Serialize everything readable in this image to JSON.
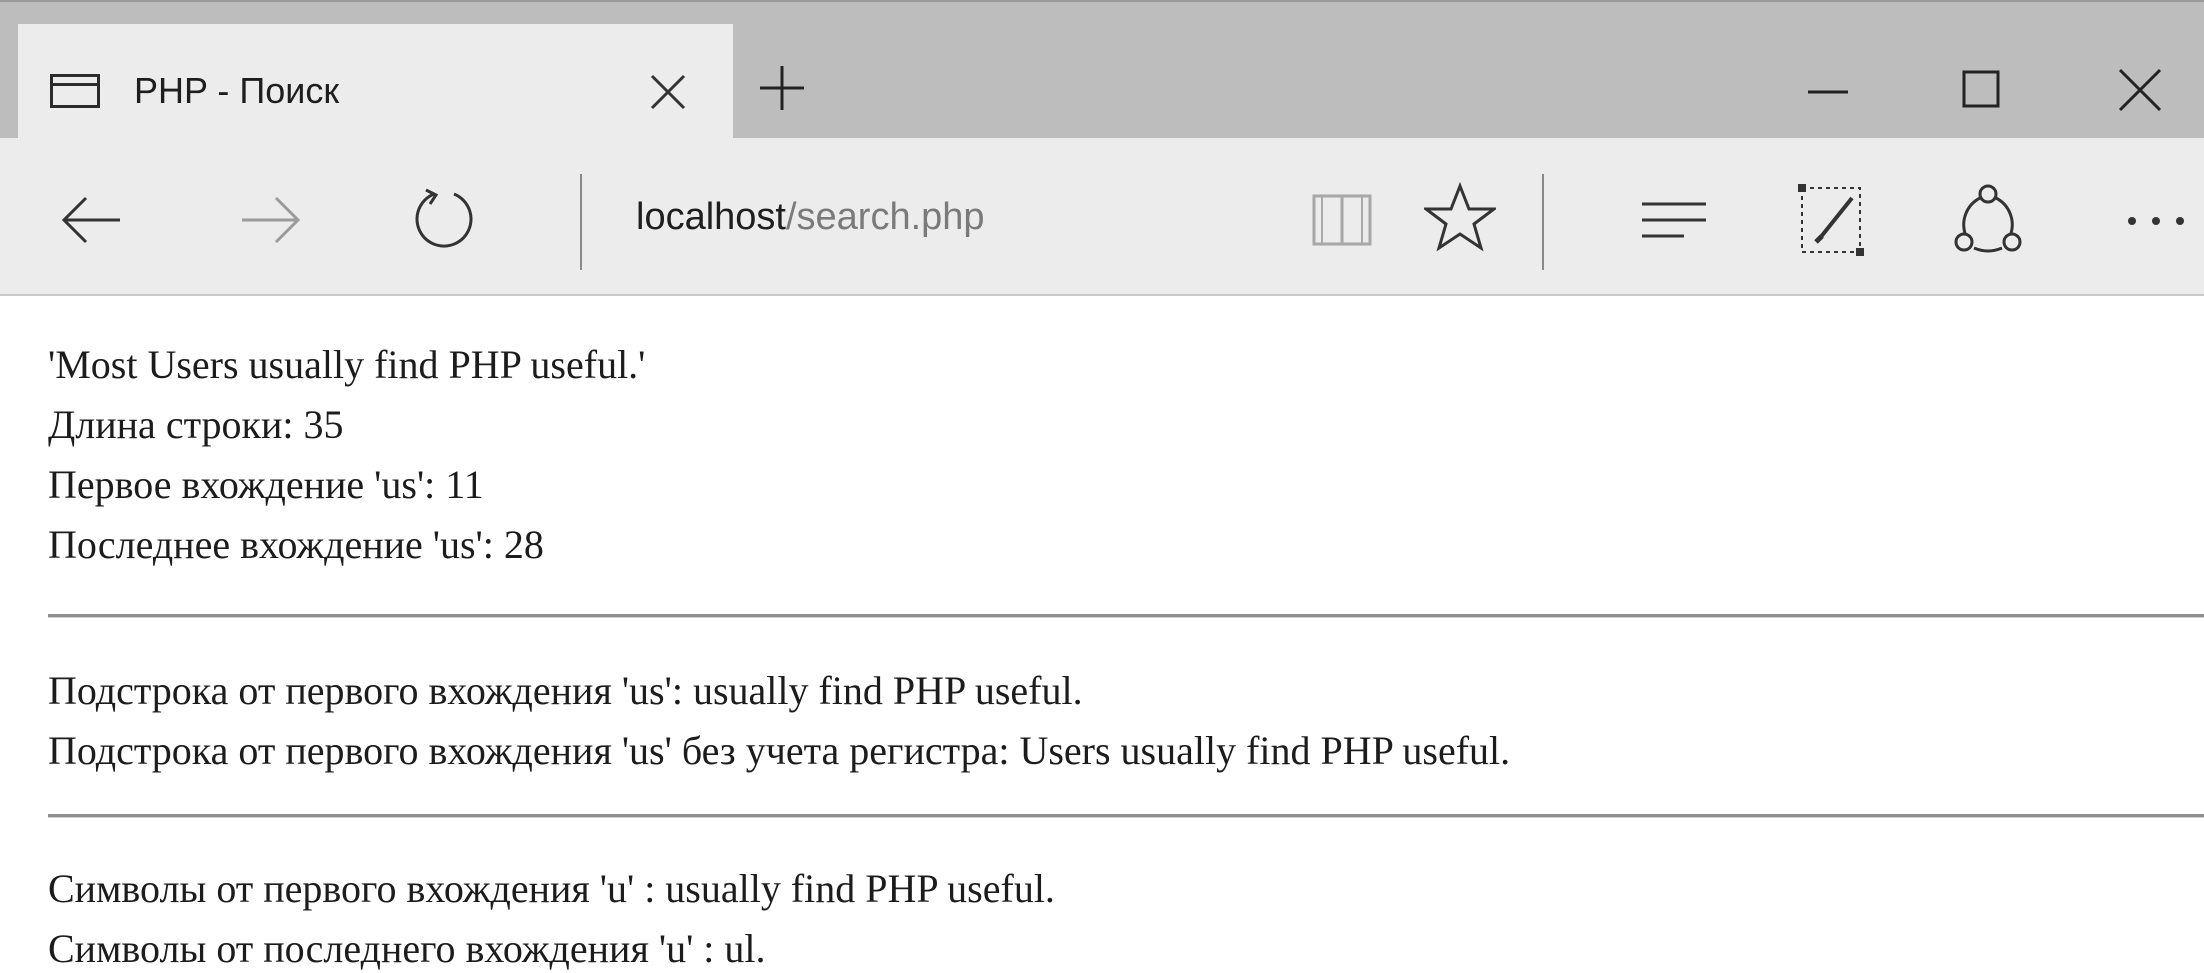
{
  "browser": {
    "tab": {
      "title": "PHP - Поиск",
      "icon": "page-icon",
      "close_icon": "close-icon"
    },
    "new_tab_icon": "plus-icon",
    "window_controls": [
      "minimize-icon",
      "maximize-icon",
      "close-icon"
    ],
    "address_bar": {
      "host": "localhost",
      "path": "/search.php"
    },
    "toolbar_icons": [
      "back-arrow-icon",
      "forward-arrow-icon",
      "refresh-icon",
      "reading-view-icon",
      "star-icon",
      "hub-icon",
      "web-note-icon",
      "share-icon",
      "more-icon"
    ]
  },
  "page": {
    "lines": [
      "'Most Users usually find PHP useful.'",
      "Длина строки: 35",
      "Первое вхождение 'us': 11",
      "Последнее вхождение 'us': 28",
      "Подстрока от первого вхождения 'us': usually find PHP useful.",
      "Подстрока от первого вхождения 'us' без учета регистра: Users usually find PHP useful.",
      "Символы от первого вхождения 'u' : usually find PHP useful.",
      "Символы от последнего вхождения 'u' : ul."
    ]
  }
}
